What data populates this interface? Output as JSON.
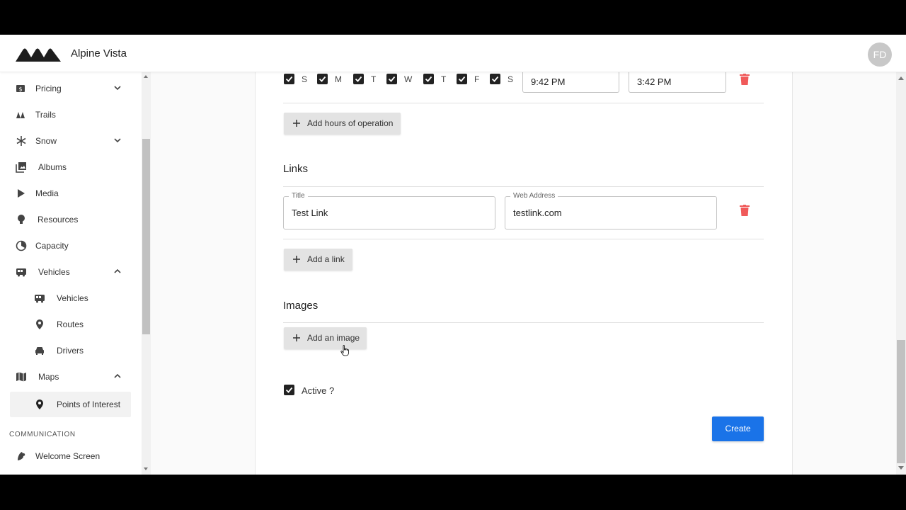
{
  "app": {
    "brand": "Alpine Vista",
    "avatar_initials": "FD"
  },
  "sidebar": {
    "items": [
      {
        "label": "Pricing",
        "icon": "dollar-icon",
        "expand": "down"
      },
      {
        "label": "Trails",
        "icon": "trail-icon"
      },
      {
        "label": "Snow",
        "icon": "snowflake-icon",
        "expand": "down"
      },
      {
        "label": "Albums",
        "icon": "albums-icon"
      },
      {
        "label": "Media",
        "icon": "play-icon"
      },
      {
        "label": "Resources",
        "icon": "lightbulb-icon"
      },
      {
        "label": "Capacity",
        "icon": "gauge-icon"
      },
      {
        "label": "Vehicles",
        "icon": "bus-icon",
        "expand": "up"
      },
      {
        "label": "Vehicles",
        "icon": "bus-icon",
        "sub": true
      },
      {
        "label": "Routes",
        "icon": "pin-icon",
        "sub": true
      },
      {
        "label": "Drivers",
        "icon": "car-icon",
        "sub": true
      },
      {
        "label": "Maps",
        "icon": "map-icon",
        "expand": "up"
      },
      {
        "label": "Points of Interest",
        "icon": "poi-pin-icon",
        "sub": true,
        "active": true
      }
    ],
    "section_label": "COMMUNICATION",
    "section_items": [
      {
        "label": "Welcome Screen",
        "icon": "welcome-icon"
      }
    ]
  },
  "hours": {
    "days": [
      "S",
      "M",
      "T",
      "W",
      "T",
      "F",
      "S"
    ],
    "days_checked": [
      true,
      true,
      true,
      true,
      true,
      true,
      true
    ],
    "open_time": "9:42 PM",
    "close_time": "3:42 PM",
    "add_label": "Add hours of operation"
  },
  "links": {
    "title": "Links",
    "title_field_label": "Title",
    "title_value": "Test Link",
    "url_field_label": "Web Address",
    "url_value": "testlink.com",
    "add_label": "Add a link"
  },
  "images": {
    "title": "Images",
    "add_label": "Add an image"
  },
  "active": {
    "label": "Active ?",
    "checked": true
  },
  "create_label": "Create",
  "colors": {
    "primary": "#1a73e8",
    "danger": "#f05a5a",
    "sidebar_active": "#f2f2f2"
  }
}
